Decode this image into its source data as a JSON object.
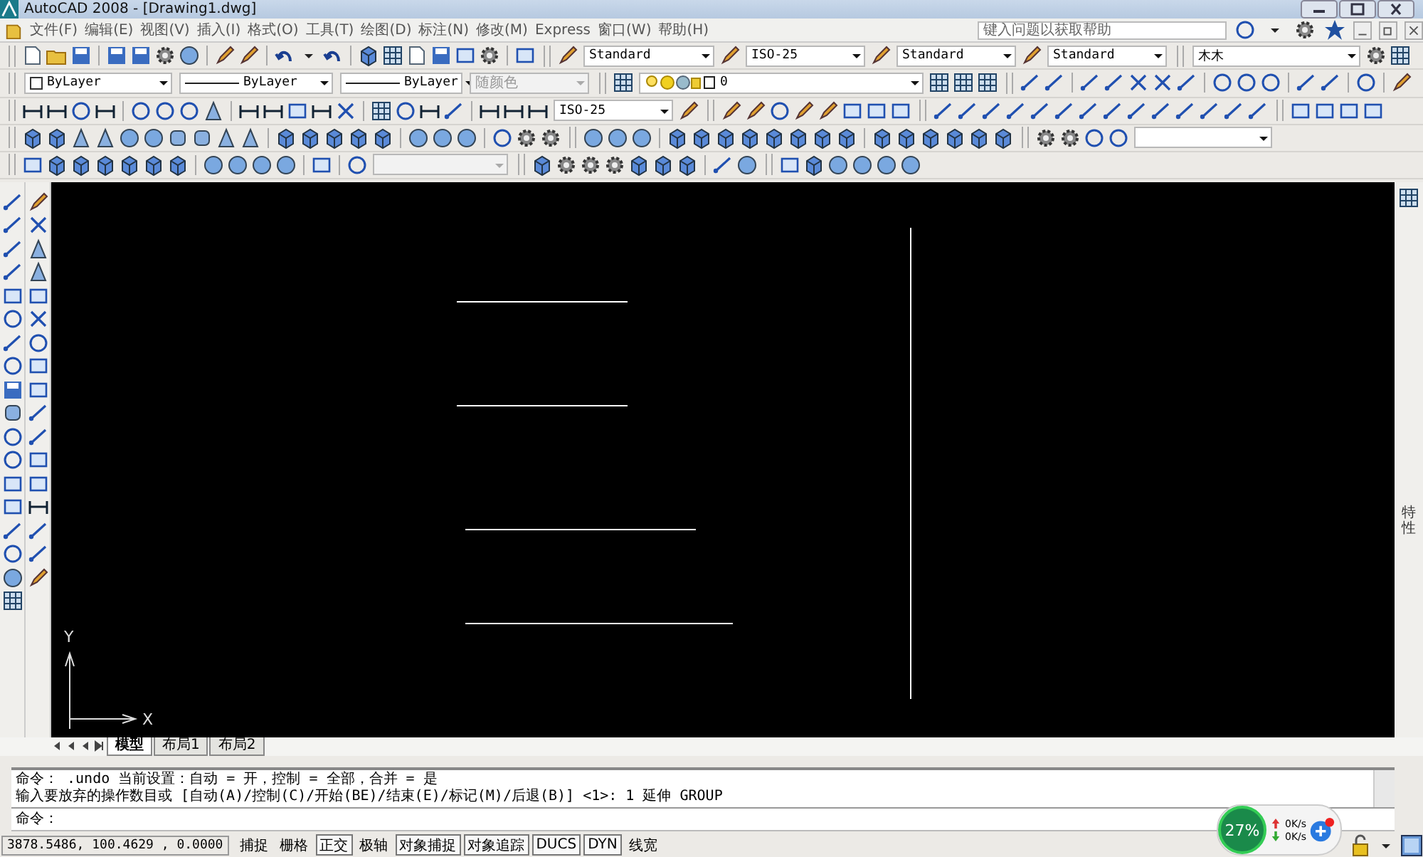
{
  "window": {
    "title": "AutoCAD 2008 - [Drawing1.dwg]"
  },
  "menu": [
    {
      "label": "文件(F)"
    },
    {
      "label": "编辑(E)"
    },
    {
      "label": "视图(V)"
    },
    {
      "label": "插入(I)"
    },
    {
      "label": "格式(O)"
    },
    {
      "label": "工具(T)"
    },
    {
      "label": "绘图(D)"
    },
    {
      "label": "标注(N)"
    },
    {
      "label": "修改(M)"
    },
    {
      "label": "Express"
    },
    {
      "label": "窗口(W)"
    },
    {
      "label": "帮助(H)"
    }
  ],
  "help_search": {
    "placeholder": "键入问题以获取帮助"
  },
  "toolbars": {
    "text_style": "Standard",
    "dim_style": "ISO-25",
    "table_style": "Standard",
    "multileader_style": "Standard",
    "workspace": "木木",
    "object_color": "ByLayer",
    "linetype": "ByLayer",
    "lineweight": "ByLayer",
    "plot_style": {
      "value": "随颜色",
      "disabled": true
    },
    "layer": "0",
    "dim_style_2": "ISO-25"
  },
  "side_palette": {
    "label": "特性"
  },
  "ucs": {
    "x_label": "X",
    "y_label": "Y"
  },
  "layout_tabs": [
    {
      "label": "模型",
      "selected": true
    },
    {
      "label": "布局1",
      "selected": false
    },
    {
      "label": "布局2",
      "selected": false
    }
  ],
  "command_history": [
    "命令：  .undo 当前设置：自动 = 开，控制 = 全部，合并 = 是",
    "输入要放弃的操作数目或 [自动(A)/控制(C)/开始(BE)/结束(E)/标记(M)/后退(B)] <1>: 1 延伸 GROUP"
  ],
  "command_prompt": "命令：",
  "status_bar": {
    "coordinates": "3878.5486, 100.4629 , 0.0000",
    "toggles": [
      {
        "label": "捕捉",
        "on": false
      },
      {
        "label": "栅格",
        "on": false
      },
      {
        "label": "正交",
        "on": true
      },
      {
        "label": "极轴",
        "on": false
      },
      {
        "label": "对象捕捉",
        "on": true
      },
      {
        "label": "对象追踪",
        "on": true
      },
      {
        "label": "DUCS",
        "on": true
      },
      {
        "label": "DYN",
        "on": true
      },
      {
        "label": "线宽",
        "on": false
      }
    ]
  },
  "network_widget": {
    "cpu": "27%",
    "upload": "0K/s",
    "download": "0K/s"
  }
}
